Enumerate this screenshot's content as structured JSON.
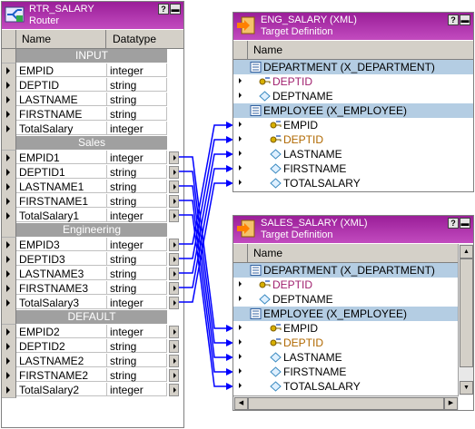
{
  "router": {
    "title": "RTR_SALARY",
    "subtitle": "Router",
    "col_name": "Name",
    "col_datatype": "Datatype",
    "groups": [
      {
        "label": "INPUT",
        "ports": [
          {
            "name": "EMPID",
            "type": "integer"
          },
          {
            "name": "DEPTID",
            "type": "string"
          },
          {
            "name": "LASTNAME",
            "type": "string"
          },
          {
            "name": "FIRSTNAME",
            "type": "string"
          },
          {
            "name": "TotalSalary",
            "type": "integer"
          }
        ]
      },
      {
        "label": "Sales",
        "ports": [
          {
            "name": "EMPID1",
            "type": "integer"
          },
          {
            "name": "DEPTID1",
            "type": "string"
          },
          {
            "name": "LASTNAME1",
            "type": "string"
          },
          {
            "name": "FIRSTNAME1",
            "type": "string"
          },
          {
            "name": "TotalSalary1",
            "type": "integer"
          }
        ]
      },
      {
        "label": "Engineering",
        "ports": [
          {
            "name": "EMPID3",
            "type": "integer"
          },
          {
            "name": "DEPTID3",
            "type": "string"
          },
          {
            "name": "LASTNAME3",
            "type": "string"
          },
          {
            "name": "FIRSTNAME3",
            "type": "string"
          },
          {
            "name": "TotalSalary3",
            "type": "integer"
          }
        ]
      },
      {
        "label": "DEFAULT",
        "ports": [
          {
            "name": "EMPID2",
            "type": "integer"
          },
          {
            "name": "DEPTID2",
            "type": "string"
          },
          {
            "name": "LASTNAME2",
            "type": "string"
          },
          {
            "name": "FIRSTNAME2",
            "type": "string"
          },
          {
            "name": "TotalSalary2",
            "type": "integer"
          }
        ]
      }
    ]
  },
  "eng_target": {
    "title": "ENG_SALARY (XML)",
    "subtitle": "Target Definition",
    "col_name": "Name",
    "rows": [
      {
        "label": "DEPARTMENT     (X_DEPARTMENT)",
        "kind": "view"
      },
      {
        "label": "DEPTID",
        "kind": "attr"
      },
      {
        "label": "DEPTNAME",
        "kind": "elem"
      },
      {
        "label": "EMPLOYEE   (X_EMPLOYEE)",
        "kind": "view"
      },
      {
        "label": "EMPID",
        "kind": "key"
      },
      {
        "label": "DEPTID",
        "kind": "fk"
      },
      {
        "label": "LASTNAME",
        "kind": "elem"
      },
      {
        "label": "FIRSTNAME",
        "kind": "elem"
      },
      {
        "label": "TOTALSALARY",
        "kind": "elem"
      }
    ]
  },
  "sales_target": {
    "title": "SALES_SALARY (XML)",
    "subtitle": "Target Definition",
    "col_name": "Name",
    "rows": [
      {
        "label": "DEPARTMENT     (X_DEPARTMENT)",
        "kind": "view"
      },
      {
        "label": "DEPTID",
        "kind": "attr"
      },
      {
        "label": "DEPTNAME",
        "kind": "elem"
      },
      {
        "label": "EMPLOYEE   (X_EMPLOYEE)",
        "kind": "view"
      },
      {
        "label": "EMPID",
        "kind": "key"
      },
      {
        "label": "DEPTID",
        "kind": "fk"
      },
      {
        "label": "LASTNAME",
        "kind": "elem"
      },
      {
        "label": "FIRSTNAME",
        "kind": "elem"
      },
      {
        "label": "TOTALSALARY",
        "kind": "elem"
      }
    ]
  },
  "buttons": {
    "help": "?",
    "minimize": "▬"
  },
  "colors": {
    "title_bar": "#a42aa2",
    "link": "#0000ff",
    "group_band": "#a0a0a0",
    "highlight": "#b4cde3"
  }
}
